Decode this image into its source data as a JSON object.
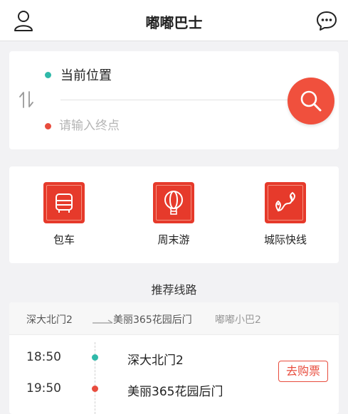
{
  "app": {
    "title": "嘟嘟巴士"
  },
  "icons": {
    "user": "user-icon",
    "message": "chat-bubble-icon",
    "swap": "swap-arrows-icon",
    "search": "search-icon"
  },
  "colors": {
    "accent_red": "#f0503d",
    "start_green": "#2fb9a9",
    "end_red": "#e84c3d"
  },
  "search": {
    "current_location": "当前位置",
    "destination_value": "",
    "destination_placeholder": "请输入终点"
  },
  "services": [
    {
      "label": "包车",
      "icon": "bus-icon"
    },
    {
      "label": "周末游",
      "icon": "hot-air-balloon-icon"
    },
    {
      "label": "城际快线",
      "icon": "route-icon"
    }
  ],
  "recommended": {
    "section_title": "推荐线路",
    "route": {
      "from": "深大北门2",
      "to": "美丽365花园后门",
      "bus_name": "嘟嘟小巴2",
      "stops": [
        {
          "time": "18:50",
          "name": "深大北门2"
        },
        {
          "time": "19:50",
          "name": "美丽365花园后门"
        }
      ],
      "buy_label": "去购票"
    }
  }
}
